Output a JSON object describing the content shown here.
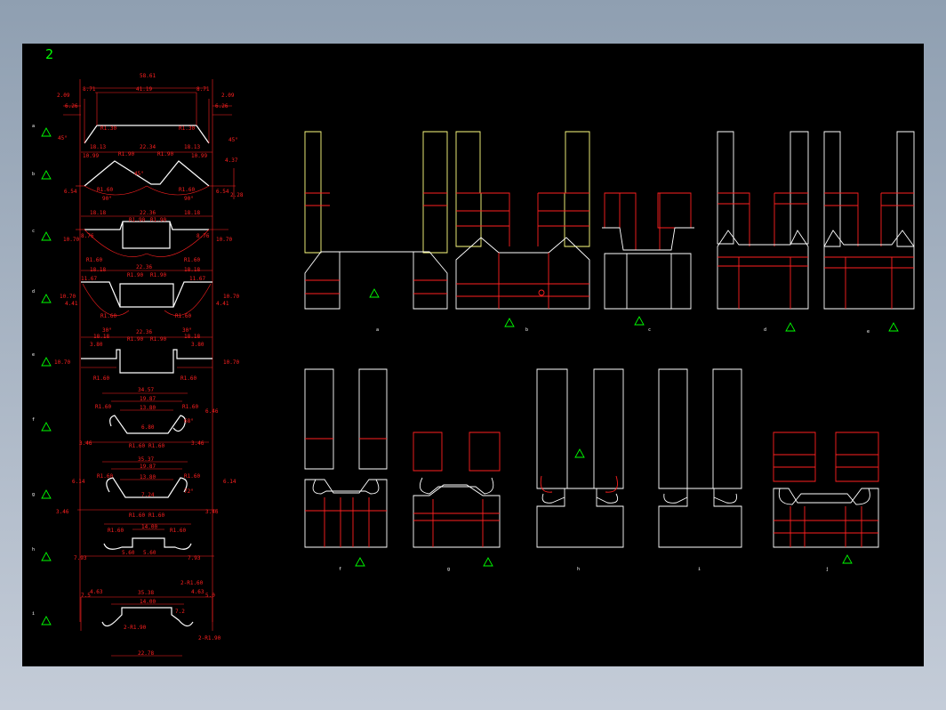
{
  "sheet": {
    "number": "2"
  },
  "colors": {
    "background": "#000000",
    "outline": "#ffffff",
    "dimension": "#ff2020",
    "tooling": "#ffff80",
    "marker": "#00ff00"
  },
  "profile_dims": {
    "top": {
      "overall": "58.61",
      "center": "41.19",
      "left_edge": "8.71",
      "right_edge": "8.71",
      "left_end": "2.09",
      "right_end": "2.09",
      "left_h": "6.26",
      "right_h": "6.26",
      "r_left": "R1.30",
      "r_right": "R1.30",
      "angle_l": "45°",
      "angle_r": "45°"
    },
    "b": {
      "a": "18.13",
      "b": "22.34",
      "c": "18.13",
      "d": "10.99",
      "e": "10.99",
      "r1": "R1.90",
      "r2": "R1.90",
      "r3": "R1.60",
      "r4": "R1.60",
      "ang": "45°",
      "ang2": "90°",
      "ang3": "90°",
      "h1": "6.54",
      "h2": "6.54",
      "h3": "4.37",
      "h4": "2.28"
    },
    "c": {
      "a": "18.18",
      "b": "22.36",
      "c": "18.18",
      "r1": "R1.90",
      "r2": "R1.90",
      "l1": "8.76",
      "l2": "8.76",
      "h1": "10.70",
      "h2": "10.70",
      "r3": "R1.60",
      "r4": "R1.60"
    },
    "d": {
      "a": "18.18",
      "b": "22.36",
      "c": "18.18",
      "r1": "R1.90",
      "r2": "R1.90",
      "l1": "11.67",
      "l2": "11.67",
      "h1": "10.70",
      "h2": "10.70",
      "h3": "4.41",
      "h4": "4.41",
      "r3": "R1.60",
      "r4": "R1.60"
    },
    "e": {
      "a": "22.36",
      "b": "18.18",
      "c": "18.18",
      "r1": "R1.90",
      "r2": "R1.90",
      "l1": "3.80",
      "l2": "3.80",
      "h1": "10.70",
      "h2": "10.70",
      "ang1": "30°",
      "ang2": "30°",
      "r3": "R1.60",
      "r4": "R1.60"
    },
    "f": {
      "a": "34.57",
      "b": "19.87",
      "c": "13.80",
      "d": "6.80",
      "r1": "R1.60",
      "r2": "R1.60",
      "r3": "R1.60",
      "r4": "R1.60",
      "ang": "68°",
      "h1": "6.46",
      "h2": "3.46",
      "h3": "3.46"
    },
    "g": {
      "a": "35.37",
      "b": "19.87",
      "c": "13.80",
      "d": "7.24",
      "r1": "R1.60",
      "r2": "R1.60",
      "ang": "72°",
      "h1": "6.14",
      "h2": "6.14",
      "h3": "3.46",
      "h4": "3.46",
      "r3": "R1.60",
      "r4": "R1.60"
    },
    "h": {
      "a": "14.00",
      "r1": "R1.60",
      "r2": "R1.60",
      "b": "7.93",
      "c": "7.93",
      "d": "5.60",
      "e": "5.60"
    },
    "i": {
      "a": "35.38",
      "b": "14.00",
      "c": "4.63",
      "d": "4.63",
      "e": "7.5",
      "f": "5.0",
      "r1": "2-R1.60",
      "r2": "2-R1.90",
      "r3": "2-R1.90",
      "g": "22.78",
      "h": "7.2"
    }
  },
  "row_labels": [
    "a",
    "b",
    "c",
    "d",
    "e",
    "f",
    "g",
    "h",
    "i"
  ],
  "station_labels_top": [
    "a",
    "b",
    "c",
    "d",
    "e"
  ],
  "station_labels_bottom": [
    "f",
    "g",
    "h",
    "i",
    "j"
  ]
}
